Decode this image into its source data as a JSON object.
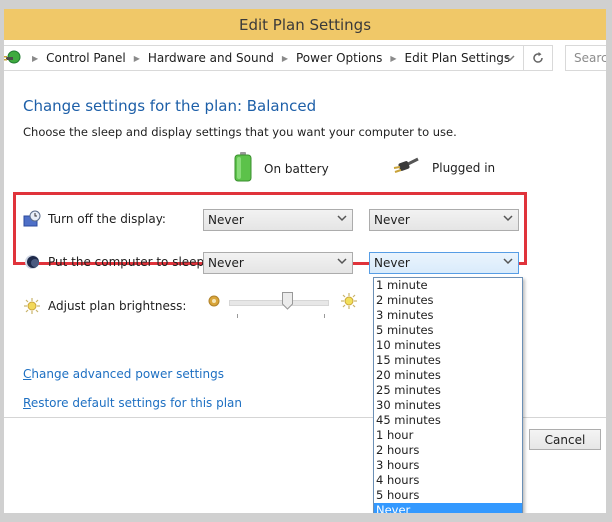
{
  "window": {
    "title": "Edit Plan Settings"
  },
  "address_bar": {
    "icon": "power-options-icon",
    "breadcrumbs": [
      "Control Panel",
      "Hardware and Sound",
      "Power Options",
      "Edit Plan Settings"
    ],
    "dropdown_icon": "chevron-down-icon",
    "refresh_icon": "refresh-icon",
    "search_placeholder": "Search"
  },
  "main": {
    "heading": "Change settings for the plan: Balanced",
    "description": "Choose the sleep and display settings that you want your computer to use.",
    "columns": [
      {
        "label": "On battery",
        "icon": "battery-icon"
      },
      {
        "label": "Plugged in",
        "icon": "power-plug-icon"
      }
    ],
    "settings": [
      {
        "label": "Turn off the display:",
        "icon": "display-timer-icon",
        "on_battery": "Never",
        "plugged_in": "Never"
      },
      {
        "label": "Put the computer to sleep:",
        "icon": "sleep-moon-icon",
        "on_battery": "Never",
        "plugged_in": "Never"
      }
    ],
    "brightness": {
      "label": "Adjust plan brightness:",
      "icon": "brightness-sun-icon",
      "min_icon": "brightness-low-icon",
      "max_icon": "brightness-high-icon",
      "value_fraction": 0.6
    },
    "links": {
      "advanced": "Change advanced power settings",
      "restore": "Restore default settings for this plan"
    },
    "highlight_color": "#e0333b"
  },
  "dropdown": {
    "options": [
      "1 minute",
      "2 minutes",
      "3 minutes",
      "5 minutes",
      "10 minutes",
      "15 minutes",
      "20 minutes",
      "25 minutes",
      "30 minutes",
      "45 minutes",
      "1 hour",
      "2 hours",
      "3 hours",
      "4 hours",
      "5 hours",
      "Never"
    ],
    "selected": "Never",
    "selected_color": "#3399ff"
  },
  "footer": {
    "cancel_label": "Cancel"
  }
}
